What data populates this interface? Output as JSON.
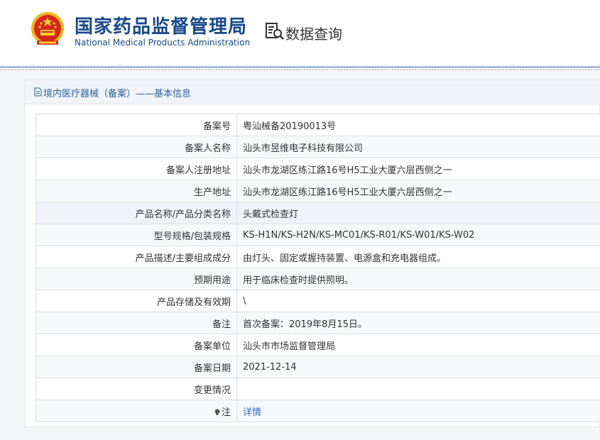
{
  "header": {
    "title": "国家药品监督管理局",
    "subtitle": "National Medical Products Administration",
    "nav_label": "数据查询",
    "brand_color": "#17498a"
  },
  "panel": {
    "title": "境内医疗器械（备案）——基本信息"
  },
  "rows": [
    {
      "label": "备案号",
      "value": "粤汕械备20190013号"
    },
    {
      "label": "备案人名称",
      "value": "汕头市昱维电子科技有限公司"
    },
    {
      "label": "备案人注册地址",
      "value": "汕头市龙湖区练江路16号H5工业大厦六层西侧之一"
    },
    {
      "label": "生产地址",
      "value": "汕头市龙湖区练江路16号H5工业大厦六层西侧之一"
    },
    {
      "label": "产品名称/产品分类名称",
      "value": "头戴式检查灯"
    },
    {
      "label": "型号规格/包装规格",
      "value": "KS-H1N/KS-H2N/KS-MC01/KS-R01/KS-W01/KS-W02"
    },
    {
      "label": "产品描述/主要组成成分",
      "value": "由灯头、固定或握持装置、电源盒和充电器组成。"
    },
    {
      "label": "预期用途",
      "value": "用于临床检查时提供照明。"
    },
    {
      "label": "产品存储及有效期",
      "value": "\\"
    },
    {
      "label": "备注",
      "value": "首次备案：2019年8月15日。"
    },
    {
      "label": "备案单位",
      "value": "汕头市市场监督管理局"
    },
    {
      "label": "备案日期",
      "value": "2021-12-14"
    },
    {
      "label": "变更情况",
      "value": ""
    },
    {
      "label": "注",
      "value": "详情"
    }
  ]
}
